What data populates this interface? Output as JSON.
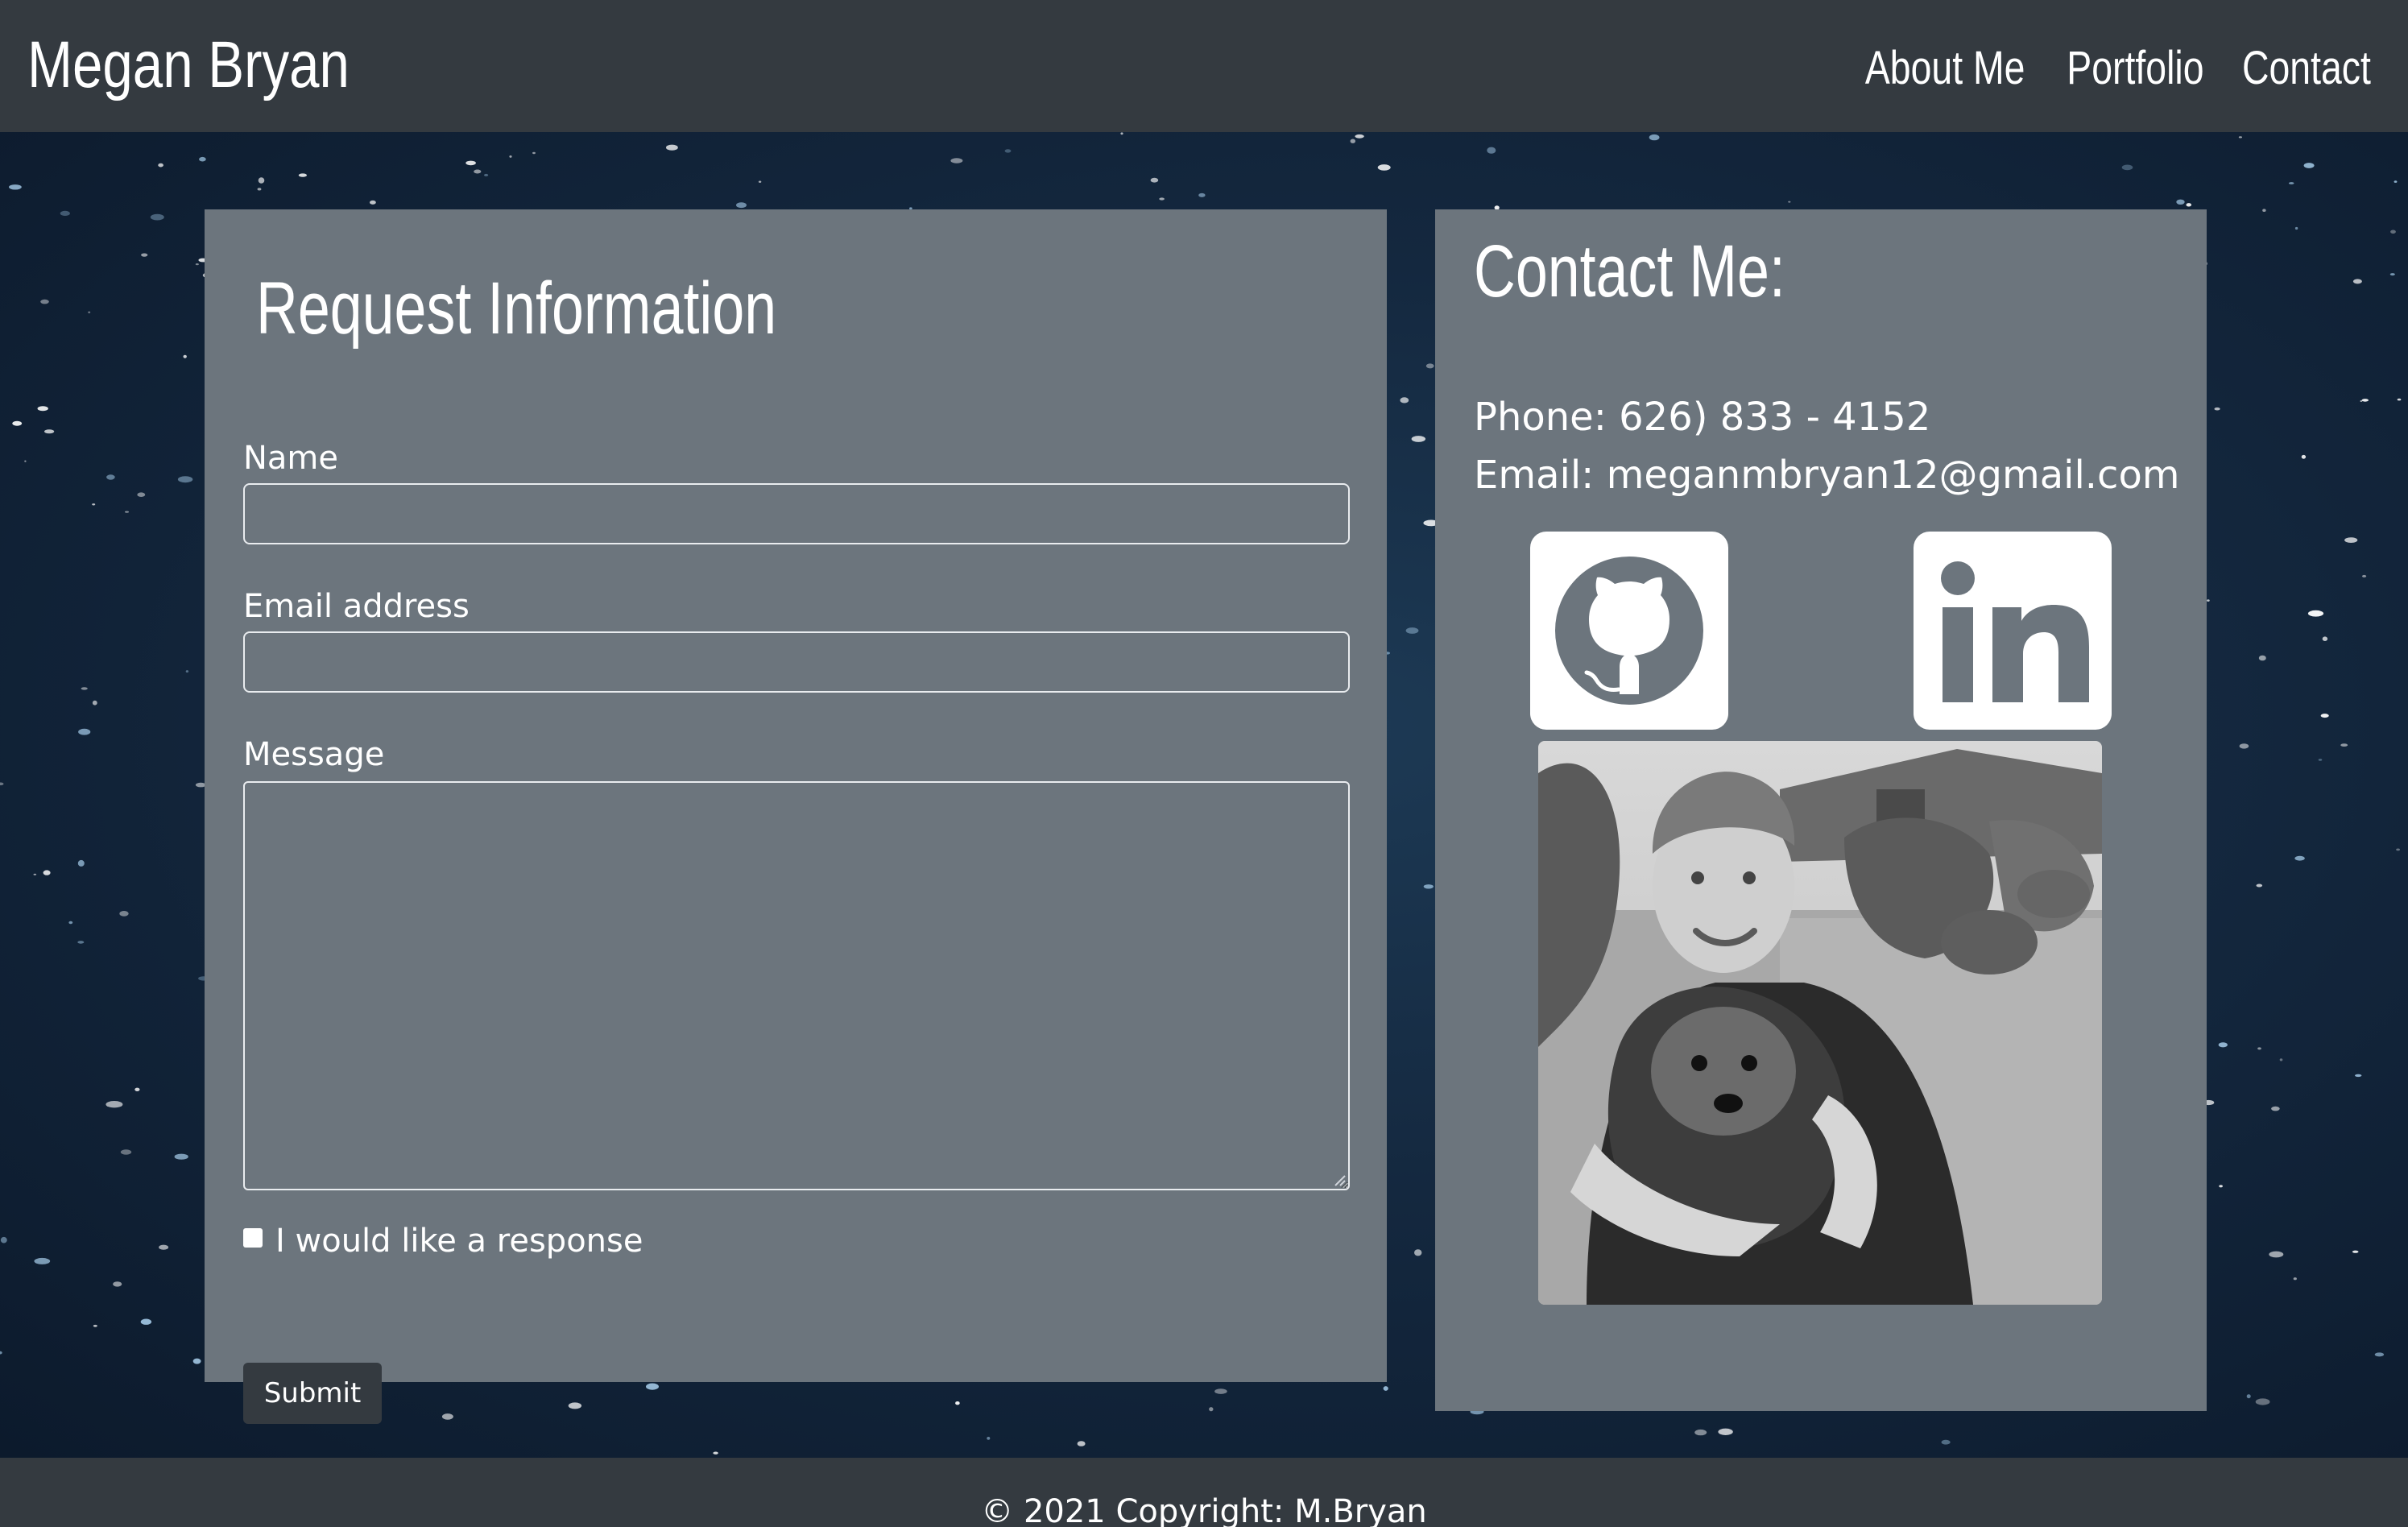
{
  "header": {
    "brand": "Megan Bryan",
    "nav": [
      "About Me",
      "Portfolio",
      "Contact"
    ]
  },
  "form": {
    "title": "Request Information",
    "name_label": "Name",
    "name_value": "",
    "email_label": "Email address",
    "email_value": "",
    "message_label": "Message",
    "message_value": "",
    "checkbox_label": "I would like a response",
    "checkbox_checked": false,
    "submit_label": "Submit"
  },
  "contact": {
    "title": "Contact Me:",
    "phone": "Phone: 626) 833 - 4152",
    "email": "Email: meganmbryan12@gmail.com",
    "icons": [
      "github-icon",
      "linkedin-icon"
    ]
  },
  "footer": {
    "copyright": "© 2021 Copyright: M.Bryan"
  },
  "colors": {
    "navbar": "#343a40",
    "card": "#6c757d",
    "button": "#343a40",
    "text": "#ffffff"
  }
}
